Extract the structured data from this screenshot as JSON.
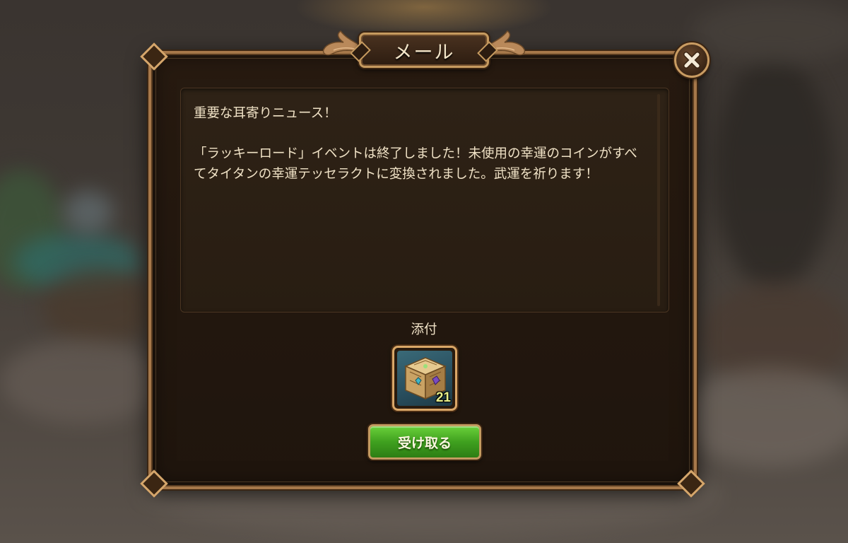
{
  "window": {
    "title": "メール"
  },
  "icons": {
    "close": "close-icon",
    "item": "item-cube-icon"
  },
  "message": {
    "body": "重要な耳寄りニュース！\n\n「ラッキーロード」イベントは終了しました！未使用の幸運のコインがすべてタイタンの幸運テッセラクトに変換されました。武運を祈ります！"
  },
  "attachment": {
    "label": "添付",
    "items": [
      {
        "icon": "titan-luck-tesseract-icon",
        "count": "21"
      }
    ]
  },
  "actions": {
    "claim_label": "受け取る"
  },
  "colors": {
    "frame": "#a6784a",
    "panel": "#1f150d",
    "text": "#f0e2c6",
    "claim_button": "#3fa01f",
    "item_count": "#e8f08a"
  }
}
